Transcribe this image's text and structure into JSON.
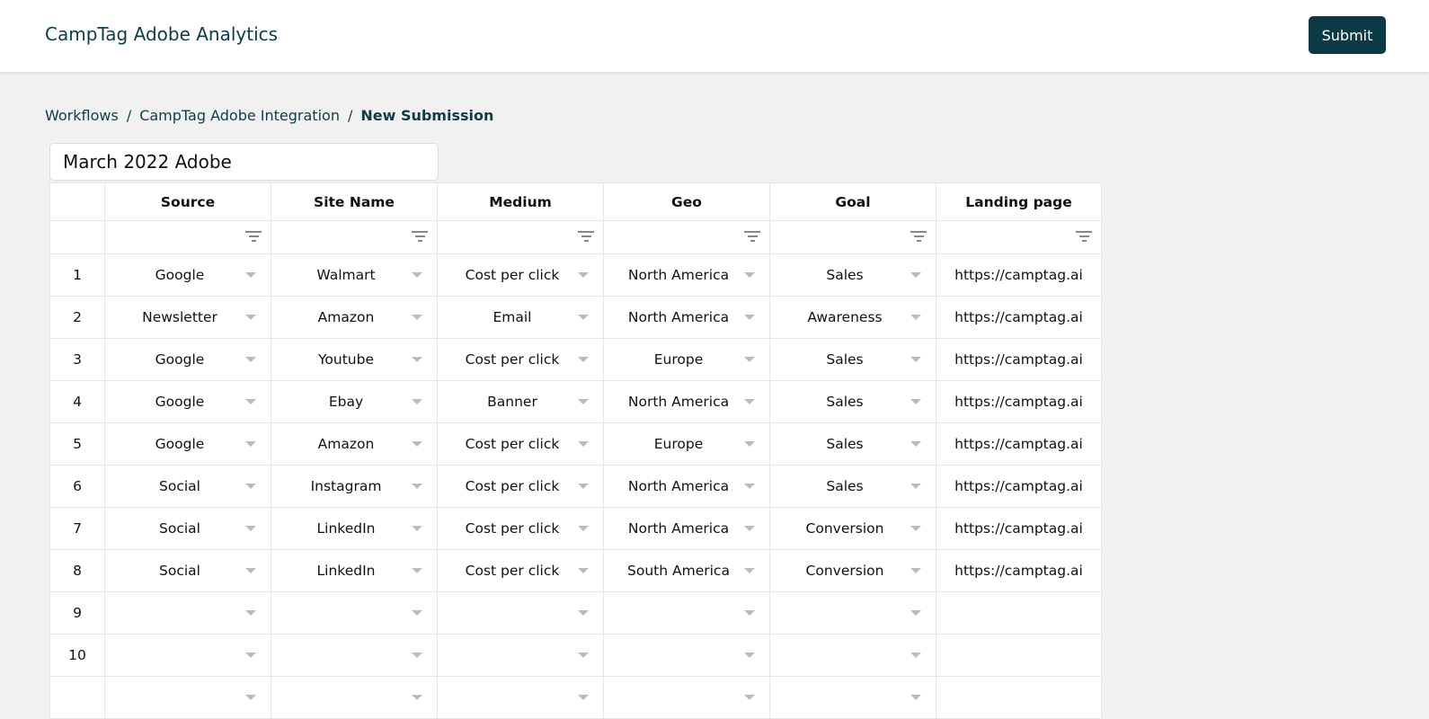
{
  "header": {
    "title": "CampTag Adobe Analytics",
    "submit_label": "Submit"
  },
  "breadcrumb": [
    "Workflows",
    "CampTag Adobe Integration",
    "New Submission"
  ],
  "submission_name": "March 2022 Adobe",
  "table": {
    "columns": [
      "Source",
      "Site Name",
      "Medium",
      "Geo",
      "Goal",
      "Landing page"
    ],
    "rows": [
      [
        "1",
        "Google",
        "Walmart",
        "Cost per click",
        "North America",
        "Sales",
        "https://camptag.ai"
      ],
      [
        "2",
        "Newsletter",
        "Amazon",
        "Email",
        "North America",
        "Awareness",
        "https://camptag.ai"
      ],
      [
        "3",
        "Google",
        "Youtube",
        "Cost per click",
        "Europe",
        "Sales",
        "https://camptag.ai"
      ],
      [
        "4",
        "Google",
        "Ebay",
        "Banner",
        "North America",
        "Sales",
        "https://camptag.ai"
      ],
      [
        "5",
        "Google",
        "Amazon",
        "Cost per click",
        "Europe",
        "Sales",
        "https://camptag.ai"
      ],
      [
        "6",
        "Social",
        "Instagram",
        "Cost per click",
        "North America",
        "Sales",
        "https://camptag.ai"
      ],
      [
        "7",
        "Social",
        "LinkedIn",
        "Cost per click",
        "North America",
        "Conversion",
        "https://camptag.ai"
      ],
      [
        "8",
        "Social",
        "LinkedIn",
        "Cost per click",
        "South America",
        "Conversion",
        "https://camptag.ai"
      ],
      [
        "9",
        "",
        "",
        "",
        "",
        "",
        ""
      ],
      [
        "10",
        "",
        "",
        "",
        "",
        "",
        ""
      ],
      [
        "",
        "",
        "",
        "",
        "",
        "",
        ""
      ]
    ]
  }
}
